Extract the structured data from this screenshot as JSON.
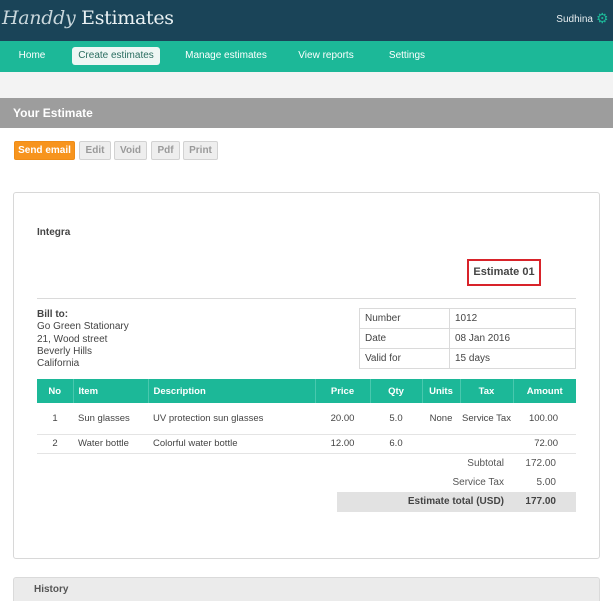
{
  "app": {
    "logo_script": "Handdy",
    "logo_text": " Estimates",
    "user": "Sudhina",
    "user_icon": "gear-icon"
  },
  "nav": {
    "items": [
      {
        "label": "Home"
      },
      {
        "label": "Create estimates",
        "active": true
      },
      {
        "label": "Manage estimates"
      },
      {
        "label": "View reports"
      },
      {
        "label": "Settings"
      }
    ]
  },
  "page": {
    "title": "Your Estimate"
  },
  "toolbar": {
    "send_email": "Send email",
    "edit": "Edit",
    "void": "Void",
    "pdf": "Pdf",
    "print": "Print"
  },
  "estimate": {
    "company": "Integra",
    "title": "Estimate 01",
    "bill_to_label": "Bill to:",
    "bill_to": [
      "Go Green Stationary",
      "21, Wood street",
      "Beverly Hills",
      "California"
    ],
    "meta": [
      {
        "key": "Number",
        "value": "1012"
      },
      {
        "key": "Date",
        "value": "08 Jan 2016"
      },
      {
        "key": "Valid for",
        "value": "15 days"
      }
    ],
    "columns": [
      "No",
      "Item",
      "Description",
      "Price",
      "Qty",
      "Units",
      "Tax",
      "Amount"
    ],
    "rows": [
      {
        "no": "1",
        "item": "Sun glasses",
        "description": "UV protection sun glasses",
        "price": "20.00",
        "qty": "5.0",
        "units": "None",
        "tax": "Service Tax",
        "amount": "100.00"
      },
      {
        "no": "2",
        "item": "Water bottle",
        "description": "Colorful water bottle",
        "price": "12.00",
        "qty": "6.0",
        "units": "",
        "tax": "",
        "amount": "72.00"
      }
    ],
    "totals": [
      {
        "label": "Subtotal",
        "value": "172.00"
      },
      {
        "label": "Service Tax",
        "value": "5.00"
      },
      {
        "label": "Estimate total (USD)",
        "value": "177.00"
      }
    ]
  },
  "history": {
    "title": "History"
  },
  "colors": {
    "header": "#1a4458",
    "accent": "#1cb898",
    "primary_button": "#f7941d",
    "highlight_border": "#d8232a"
  }
}
